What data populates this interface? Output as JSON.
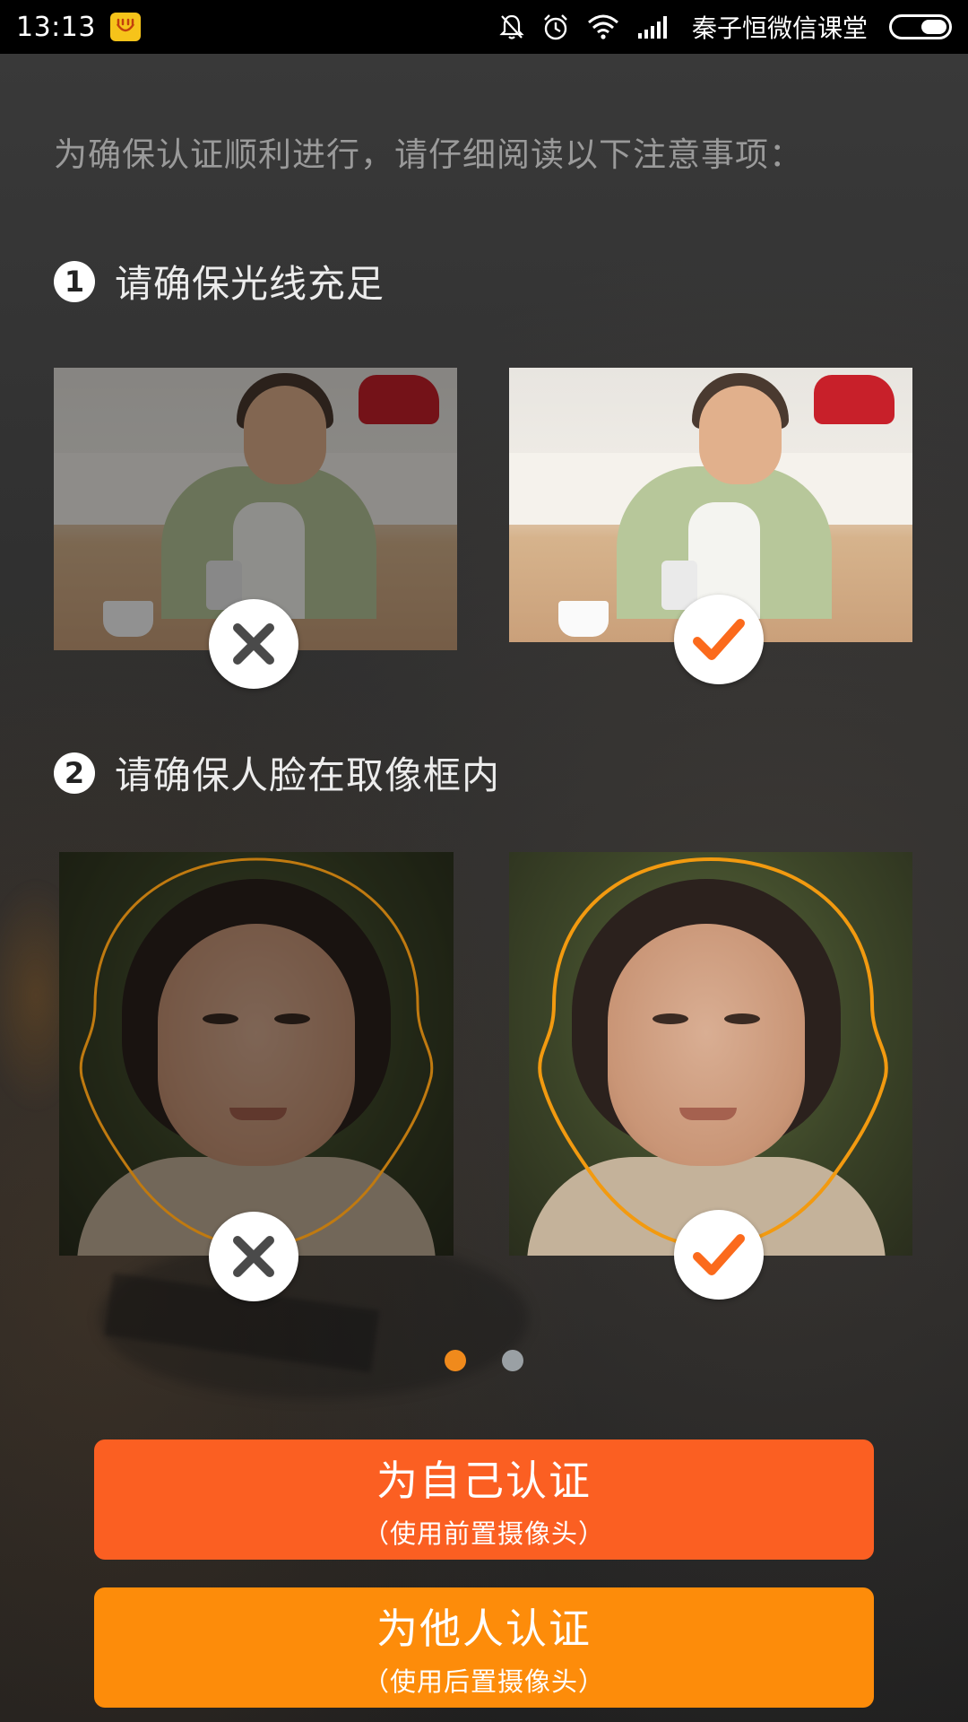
{
  "status_bar": {
    "time": "13:13",
    "carrier": "秦子恒微信课堂"
  },
  "intro_text": "为确保认证顺利进行，请仔细阅读以下注意事项：",
  "steps": [
    {
      "number": "1",
      "label": "请确保光线充足"
    },
    {
      "number": "2",
      "label": "请确保人脸在取像框内"
    }
  ],
  "pager": {
    "active_color": "#f08a1c",
    "inactive_color": "#9aa0a4",
    "active_index": 0,
    "count": 2
  },
  "buttons": {
    "self": {
      "title": "为自己认证",
      "subtitle": "（使用前置摄像头）",
      "color": "#fb5f22"
    },
    "others": {
      "title": "为他人认证",
      "subtitle": "（使用后置摄像头）",
      "color": "#fd8c0a"
    }
  },
  "colors": {
    "accent_check": "#fb6a1c",
    "wrong_mark": "#4a4a4a",
    "frame_outline": "#f29a10"
  }
}
